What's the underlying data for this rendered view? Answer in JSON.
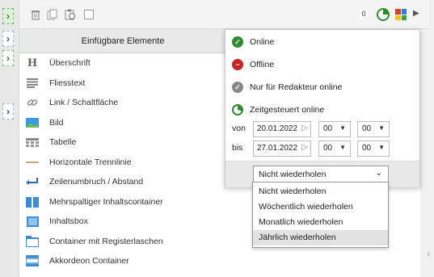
{
  "toolbar": {
    "counter": "0",
    "icons": [
      "trash-icon",
      "copy-icon",
      "paste-icon",
      "checkbox-icon",
      "clock-status-icon",
      "grid-colors-icon",
      "arrow-right-icon"
    ]
  },
  "panel": {
    "header": "Einfügbare Elemente",
    "items": [
      {
        "label": "Überschrift",
        "icon": "heading-icon"
      },
      {
        "label": "Fliesstext",
        "icon": "text-lines-icon"
      },
      {
        "label": "Link / Schaltfläche",
        "icon": "link-icon"
      },
      {
        "label": "Bild",
        "icon": "image-icon"
      },
      {
        "label": "Tabelle",
        "icon": "table-icon"
      },
      {
        "label": "Horizontale Trennlinie",
        "icon": "hr-icon"
      },
      {
        "label": "Zeilenumbruch / Abstand",
        "icon": "line-break-icon"
      },
      {
        "label": "Mehrspaltiger Inhaltscontainer",
        "icon": "columns-icon"
      },
      {
        "label": "Inhaltsbox",
        "icon": "box-icon"
      },
      {
        "label": "Container mit Registerlaschen",
        "icon": "tabs-icon"
      },
      {
        "label": "Akkordeon Container",
        "icon": "accordion-icon"
      }
    ]
  },
  "status": {
    "online": "Online",
    "offline": "Offline",
    "editor_only": "Nur für Redakteur online",
    "scheduled": "Zeitgesteuert online",
    "from_label": "von",
    "to_label": "bis",
    "from_date": "20.01.2022",
    "to_date": "27.01.2022",
    "from_hour": "00",
    "from_min": "00",
    "to_hour": "00",
    "to_min": "00",
    "repeat_selected": "Nicht wiederholen",
    "repeat_options": [
      "Nicht wiederholen",
      "Wöchentlich wiederholen",
      "Monatlich wiederholen",
      "Jährlich wiederholen"
    ]
  },
  "colors": {
    "online_green": "#2e8b2e",
    "offline_red": "#cc2222",
    "editor_gray": "#888888",
    "accent_blue": "#1a4ea5"
  }
}
